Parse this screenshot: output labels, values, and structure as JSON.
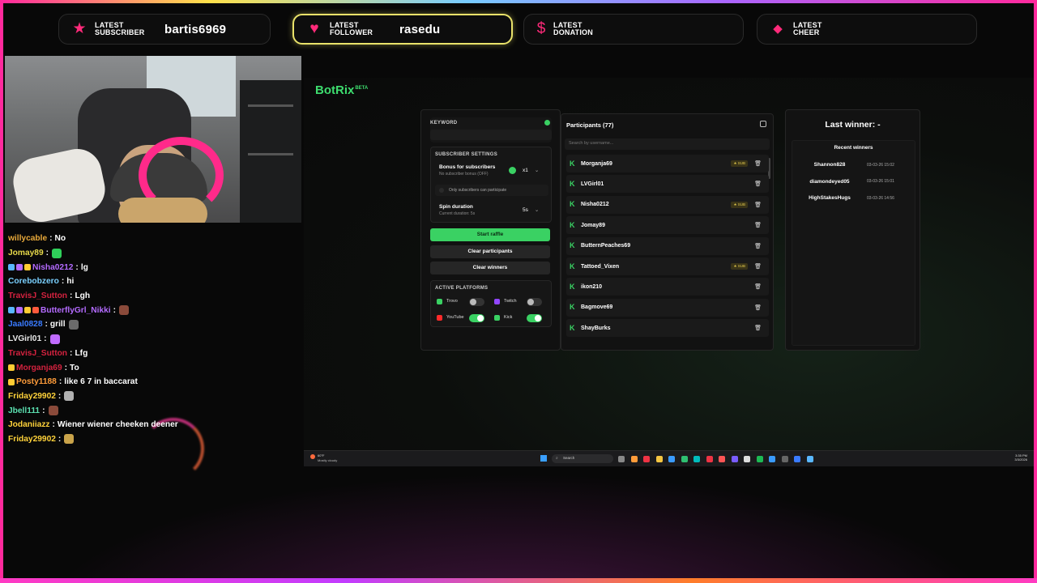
{
  "alerts": [
    {
      "icon": "★",
      "label_line1": "LATEST",
      "label_line2": "SUBSCRIBER",
      "value": "bartis6969",
      "active": false
    },
    {
      "icon": "♥",
      "label_line1": "LATEST",
      "label_line2": "FOLLOWER",
      "value": "rasedu",
      "active": true
    },
    {
      "icon": "$",
      "label_line1": "LATEST",
      "label_line2": "DONATION",
      "value": "",
      "active": false
    },
    {
      "icon": "◆",
      "label_line1": "LATEST",
      "label_line2": "CHEER",
      "value": "",
      "active": false
    }
  ],
  "chat": [
    {
      "user": "willycable",
      "color": "#e8a93a",
      "text": "No",
      "badges": [],
      "emote": false
    },
    {
      "user": "Jomay89",
      "color": "#e6d94a",
      "text": "",
      "badges": [],
      "emote": true,
      "emote_color": "#2fd05a"
    },
    {
      "user": "Nisha0212",
      "color": "#b46bff",
      "text": "lg",
      "badges": [
        "#59b7ff",
        "#b46bff",
        "#ffcc33"
      ],
      "emote": false
    },
    {
      "user": "Corebobzero",
      "color": "#7ad0ff",
      "text": "hi",
      "badges": [],
      "emote": false
    },
    {
      "user": "TravisJ_Sutton",
      "color": "#d4223f",
      "text": "Lgh",
      "badges": [],
      "emote": false
    },
    {
      "user": "ButterflyGrl_Nikki",
      "color": "#b46bff",
      "text": "",
      "badges": [
        "#59b7ff",
        "#b46bff",
        "#ffcc33",
        "#ff5a3d"
      ],
      "emote": true,
      "emote_color": "#8a4a3a"
    },
    {
      "user": "Jaal0828",
      "color": "#3a7bff",
      "text": "grill",
      "badges": [],
      "emote": true,
      "emote_color": "#6b6b6b"
    },
    {
      "user": "LVGirl01",
      "color": "#e8e8e8",
      "text": "",
      "badges": [],
      "emote": true,
      "emote_color": "#c06bff"
    },
    {
      "user": "TravisJ_Sutton",
      "color": "#d4223f",
      "text": "Lfg",
      "badges": [],
      "emote": false
    },
    {
      "user": "Morganja69",
      "color": "#d4223f",
      "text": "To",
      "badges": [
        "#ffcc33"
      ],
      "emote": false
    },
    {
      "user": "Posty1188",
      "color": "#ff9c3a",
      "text": "like 6 7 in baccarat",
      "badges": [
        "#ffcc33"
      ],
      "emote": false
    },
    {
      "user": "Friday29902",
      "color": "#ffd23a",
      "text": "",
      "badges": [],
      "emote": true,
      "emote_color": "#b0b0b0"
    },
    {
      "user": "Jbell111",
      "color": "#5be0b0",
      "text": "",
      "badges": [],
      "emote": true,
      "emote_color": "#8a4a3a"
    },
    {
      "user": "Jodaniiazz",
      "color": "#ffd23a",
      "text": "Wiener wiener cheeken deener",
      "badges": [],
      "emote": false
    },
    {
      "user": "Friday29902",
      "color": "#ffd23a",
      "text": "",
      "badges": [],
      "emote": true,
      "emote_color": "#c9a34a"
    }
  ],
  "botrix": {
    "logo": "BotRix",
    "logo_badge": "BETA",
    "keyword_label": "KEYWORD",
    "subscriber_settings_label": "SUBSCRIBER SETTINGS",
    "bonus_title": "Bonus for subscribers",
    "bonus_sub": "No subscriber bonus (OFF)",
    "bonus_value": "x1",
    "only_subs_label": "Only subscribers can participate",
    "spin_title": "Spin duration",
    "spin_sub": "Current duration: 5s",
    "spin_value": "5s",
    "start_btn": "Start raffle",
    "clear_participants_btn": "Clear participants",
    "clear_winners_btn": "Clear winners",
    "active_platforms_label": "ACTIVE PLATFORMS",
    "platforms": [
      {
        "name": "Trovo",
        "enabled": false,
        "icon_color": "#3ad163"
      },
      {
        "name": "Twitch",
        "enabled": false,
        "icon_color": "#9146ff"
      },
      {
        "name": "YouTube",
        "enabled": true,
        "icon_color": "#ff2a2a"
      },
      {
        "name": "Kick",
        "enabled": true,
        "icon_color": "#3ad163"
      }
    ],
    "participants_title": "Participants (77)",
    "search_placeholder": "Search by username...",
    "participants": [
      {
        "name": "Morganja69",
        "sub": true
      },
      {
        "name": "LVGirl01",
        "sub": false
      },
      {
        "name": "Nisha0212",
        "sub": true
      },
      {
        "name": "Jomay89",
        "sub": false
      },
      {
        "name": "ButternPeaches69",
        "sub": false
      },
      {
        "name": "Tattoed_Vixen",
        "sub": true
      },
      {
        "name": "ikon210",
        "sub": false
      },
      {
        "name": "Bagmove69",
        "sub": false
      },
      {
        "name": "ShayBurks",
        "sub": false
      }
    ],
    "sub_badge": "★ SUB",
    "last_winner": "Last winner: -",
    "recent_winners_label": "Recent winners",
    "recent_winners": [
      {
        "name": "Shannon828",
        "date": "03-03-26 15:02"
      },
      {
        "name": "diamondeyed05",
        "date": "03-03-26 15:01"
      },
      {
        "name": "HighStakesHugs",
        "date": "03-03-26 14:56"
      }
    ]
  },
  "taskbar": {
    "weather_temp": "60°F",
    "weather_text": "Mostly cloudy",
    "search_label": "Search",
    "time": "3:35 PM",
    "date": "3/3/2026"
  },
  "colors": {
    "accent": "#3ad163",
    "brand": "#ff2a7a"
  }
}
